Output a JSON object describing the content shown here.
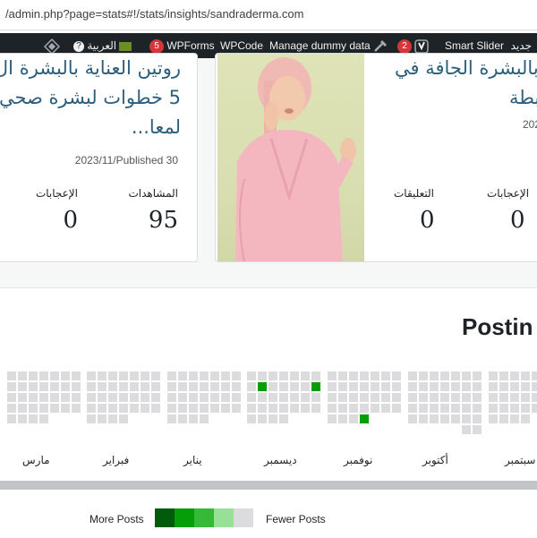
{
  "browser": {
    "url": "/admin.php?page=stats#!/stats/insights/sandraderma.com"
  },
  "adminbar": {
    "new_label": "جديد",
    "smart_slider": "Smart Slider",
    "yoast_count": "2",
    "manage_dummy": "Manage dummy data",
    "wpcode": "WPCode",
    "wpforms_count": "5",
    "wpforms": "WPForms",
    "language": "العربية",
    "help": "?"
  },
  "cards": [
    {
      "title_lines": [
        "روتين العناية بالبشرة ال",
        "5 خطوات لبشرة صحي",
        "لمعا..."
      ],
      "date": "2023/11/Published 30",
      "stats": [
        {
          "label": "المشاهدات",
          "value": "95"
        },
        {
          "label": "الإعجابات",
          "value": "0"
        }
      ]
    },
    {
      "title_lines": [
        "ة بالبشرة الجافة في",
        "بطة"
      ],
      "date": "202",
      "stats": [
        {
          "label": "الإعجابات",
          "value": "0"
        },
        {
          "label": "التعليقات",
          "value": "0"
        }
      ]
    }
  ],
  "activity": {
    "title": "Postin",
    "months": [
      "سبتمبر",
      "أكتوبر",
      "نوفمبر",
      "ديسمبر",
      "يناير",
      "فبراير",
      "مارس"
    ],
    "legend": {
      "more": "More Posts",
      "fewer": "Fewer Posts",
      "colors": [
        "#005b0c",
        "#069e08",
        "#36b936",
        "#98df98",
        "#dcdcde"
      ]
    }
  }
}
